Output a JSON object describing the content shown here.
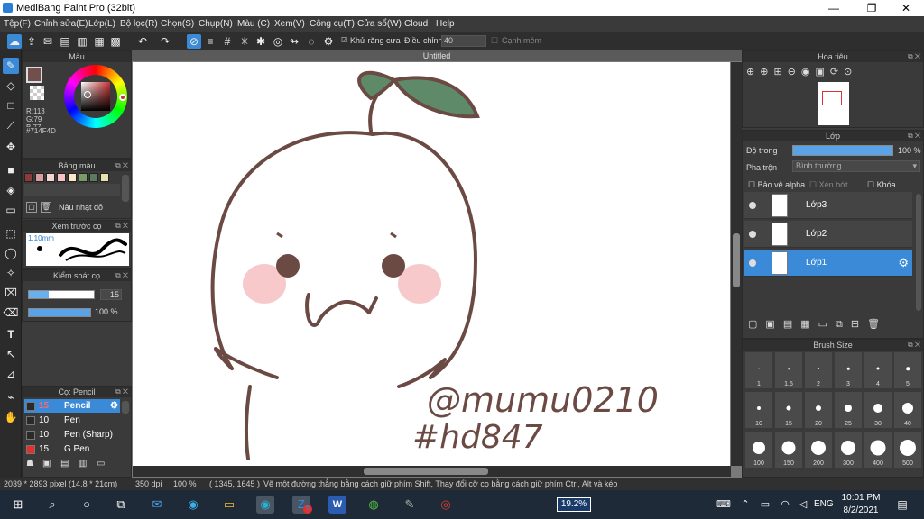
{
  "window": {
    "title": "MediBang Paint Pro (32bit)",
    "min": "—",
    "max": "❐",
    "close": "✕"
  },
  "menu": [
    "Tệp(F)",
    "Chỉnh sửa(E)",
    "Lớp(L)",
    "Bộ lọc(R)",
    "Chọn(S)",
    "Chụp(N)",
    "Màu (C)",
    "Xem(V)",
    "Công cụ(T)",
    "Cửa sổ(W)",
    "Cloud",
    "Help"
  ],
  "toolbar": {
    "antialias_label": "Khử răng cưa",
    "adjust_label": "Điều chỉnh",
    "adjust_value": "40",
    "edge_label": "Cạnh mềm"
  },
  "color_panel": {
    "title": "Màu",
    "r": "R:113",
    "g": "G:79",
    "b": "B:77",
    "hex": "#714F4D",
    "current_color": "#714F4D"
  },
  "palette_panel": {
    "title": "Bảng màu",
    "swatches": [
      "#8c3a3a",
      "#d9a0a0",
      "#f3d6cf",
      "#f7c1c8",
      "#fde7c8",
      "#7a9a6a",
      "#5c7a5c",
      "#e8e0b0"
    ],
    "selected_name": "Nâu nhạt đỏ"
  },
  "brush_preview": {
    "title": "Xem trước cọ",
    "size_label": "1.10mm"
  },
  "brush_control": {
    "title": "Kiểm soát cọ",
    "size": "15",
    "opacity": "100 %"
  },
  "brush_list": {
    "title": "Cọ: Pencil",
    "items": [
      {
        "size": "15",
        "name": "Pencil",
        "color": "#2a2a2a",
        "selected": true
      },
      {
        "size": "10",
        "name": "Pen",
        "color": "#2a2a2a"
      },
      {
        "size": "10",
        "name": "Pen (Sharp)",
        "color": "#2a2a2a"
      },
      {
        "size": "15",
        "name": "G Pen",
        "color": "#e03030"
      }
    ]
  },
  "document": {
    "tab": "Untitled"
  },
  "canvas_art": {
    "text1": "@mumu0210",
    "text2": "#hd847"
  },
  "navigator": {
    "title": "Hoa tiêu"
  },
  "layer_panel": {
    "title": "Lớp",
    "opacity_label": "Độ trong",
    "opacity_value": "100 %",
    "blend_label": "Pha trộn",
    "blend_value": "Bình thường",
    "alpha_label": "Bảo vệ alpha",
    "clip_label": "Xén bớt",
    "lock_label": "Khóa",
    "layers": [
      {
        "name": "Lớp3"
      },
      {
        "name": "Lớp2"
      },
      {
        "name": "Lớp1",
        "selected": true
      }
    ]
  },
  "brush_size_panel": {
    "title": "Brush Size",
    "sizes": [
      "1",
      "1.5",
      "2",
      "3",
      "4",
      "5",
      "10",
      "15",
      "20",
      "25",
      "30",
      "40",
      "100",
      "150",
      "200",
      "300",
      "400",
      "500"
    ]
  },
  "status": {
    "dimensions": "2039 * 2893 pixel   (14.8 * 21cm)",
    "dpi": "350 dpi",
    "zoom": "100 %",
    "coords": "( 1345, 1645 )",
    "hint": "Vẽ một đường thẳng bằng cách giữ phím Shift, Thay đổi cỡ cọ bằng cách giữ phím Ctrl, Alt và kéo"
  },
  "taskbar": {
    "battery": "19.2%",
    "lang": "ENG",
    "time": "10:01 PM",
    "date": "8/2/2021",
    "notif_count": "5"
  }
}
